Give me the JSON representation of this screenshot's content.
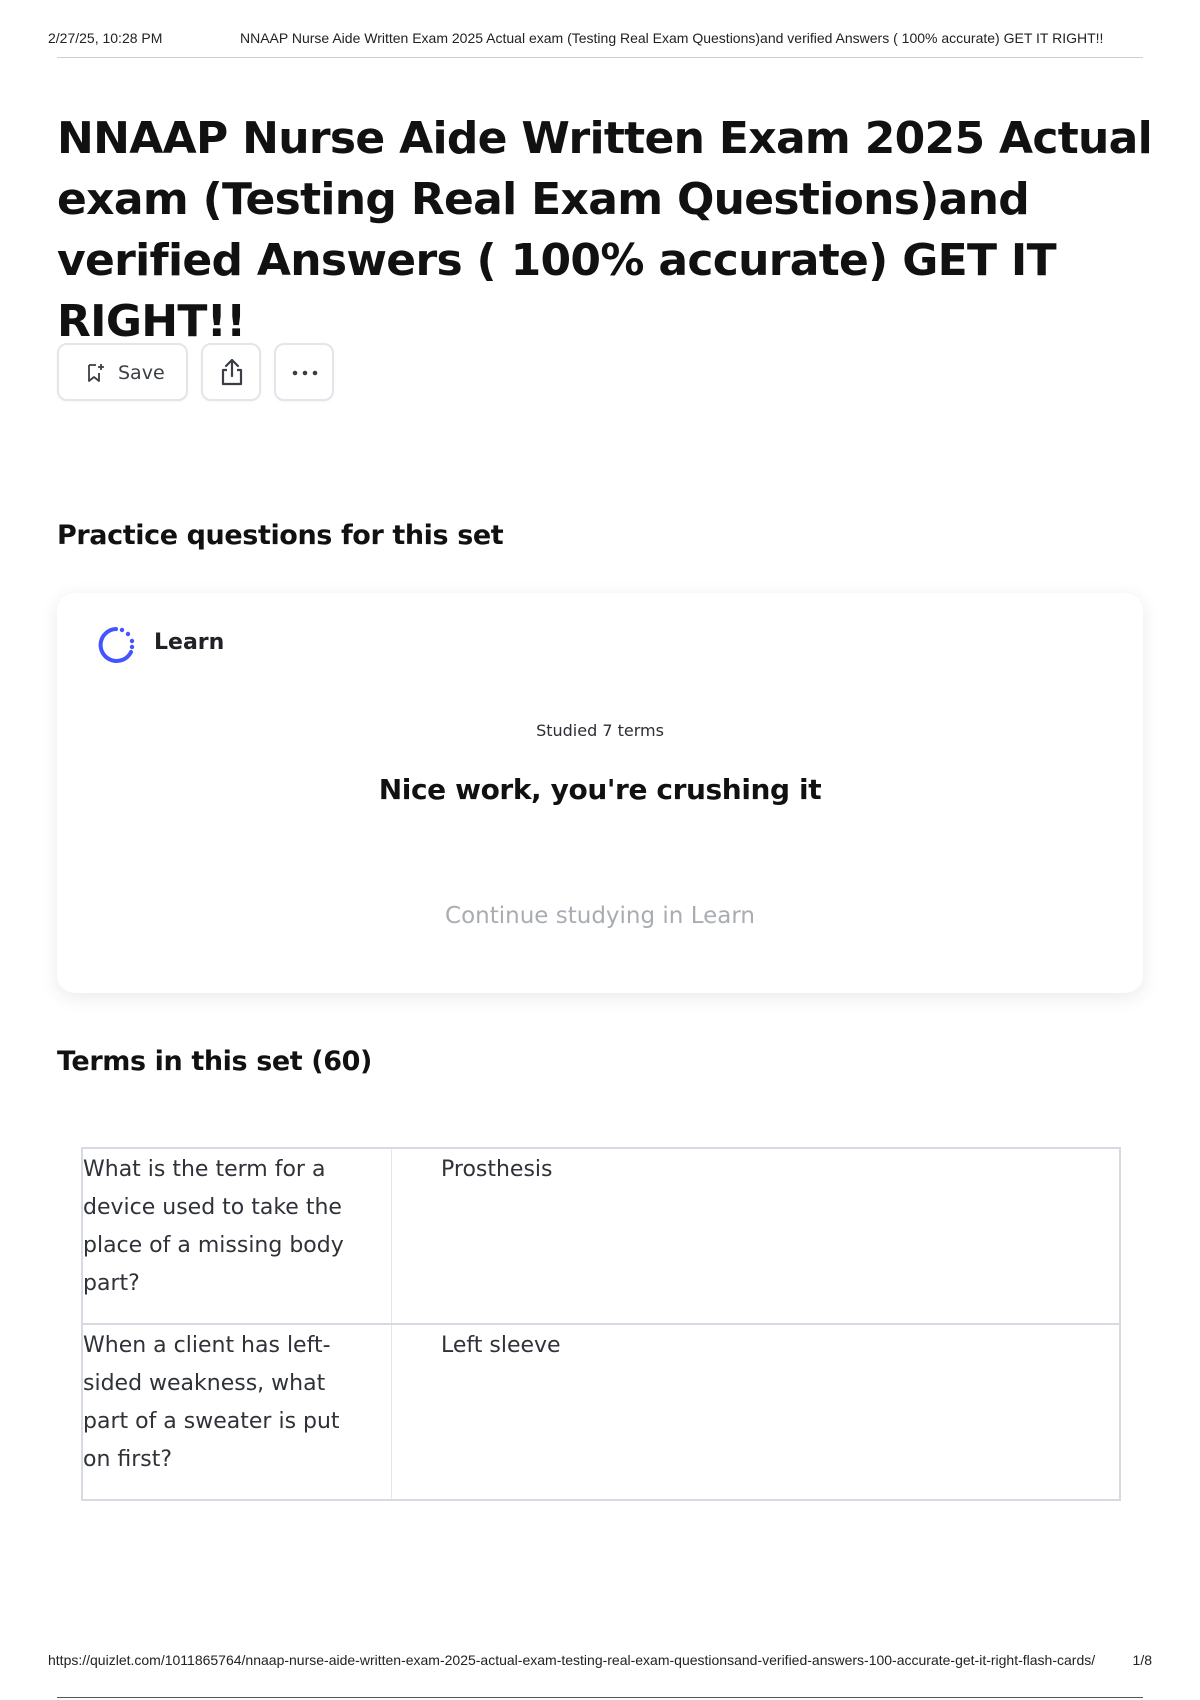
{
  "print_header": {
    "datetime": "2/27/25, 10:28 PM",
    "doc_title": "NNAAP Nurse Aide Written Exam 2025 Actual exam (Testing Real Exam Questions)and verified Answers ( 100% accurate) GET IT RIGHT!!"
  },
  "page": {
    "title": "NNAAP Nurse Aide Written Exam 2025 Actual exam (Testing Real Exam Questions)and verified Answers ( 100% accurate) GET IT RIGHT!!"
  },
  "actions": {
    "save_label": "Save",
    "save_icon": "bookmark-plus-icon",
    "share_icon": "share-icon",
    "more_icon": "more-options-icon"
  },
  "practice": {
    "heading": "Practice questions for this set",
    "card": {
      "mode_label": "Learn",
      "mode_icon": "learn-progress-icon",
      "studied_text": "Studied 7 terms",
      "praise_text": "Nice work, you're crushing it",
      "continue_label": "Continue studying in Learn"
    }
  },
  "terms": {
    "heading": "Terms in this set (60)",
    "items": [
      {
        "question": "What is the term for a device used to take the place of a missing body part?",
        "answer": "Prosthesis"
      },
      {
        "question": "When a client has left-sided weakness, what part of a sweater is put on first?",
        "answer": "Left sleeve"
      }
    ]
  },
  "print_footer": {
    "url": "https://quizlet.com/1011865764/nnaap-nurse-aide-written-exam-2025-actual-exam-testing-real-exam-questionsand-verified-answers-100-accurate-get-it-right-flash-cards/",
    "page_number": "1/8"
  },
  "colors": {
    "accent": "#4255ff",
    "text": "#111111",
    "muted_link": "#a9acb3",
    "border": "#d7dae2"
  }
}
